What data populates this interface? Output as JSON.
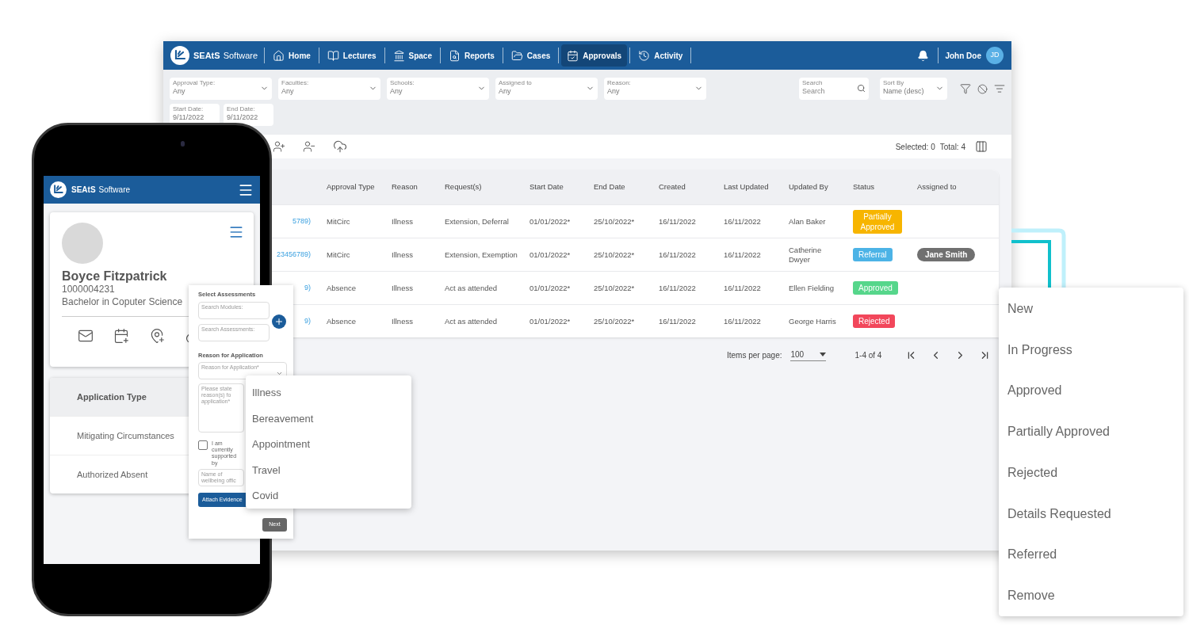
{
  "desktop": {
    "nav": {
      "brand": "SEAtS",
      "product": "Software",
      "items": [
        {
          "label": "Home",
          "selected": false
        },
        {
          "label": "Lectures",
          "selected": false
        },
        {
          "label": "Space",
          "selected": false
        },
        {
          "label": "Reports",
          "selected": false
        },
        {
          "label": "Cases",
          "selected": false
        },
        {
          "label": "Approvals",
          "selected": true
        },
        {
          "label": "Activity",
          "selected": false
        }
      ],
      "user": "John Doe",
      "initials": "JD"
    },
    "filters": [
      {
        "label": "Approval Type:",
        "value": "Any"
      },
      {
        "label": "Faculties:",
        "value": "Any"
      },
      {
        "label": "Schools:",
        "value": "Any"
      },
      {
        "label": "Assigned to",
        "value": "Any"
      },
      {
        "label": "Reason:",
        "value": "Any"
      }
    ],
    "search": {
      "label": "Search",
      "placeholder": "Search"
    },
    "sort": {
      "label": "Sort By",
      "value": "Name (desc)"
    },
    "dates": [
      {
        "label": "Start Date:",
        "value": "9/11/2022"
      },
      {
        "label": "End Date:",
        "value": "9/11/2022"
      }
    ],
    "selected_count": "Selected: 0",
    "total": "Total: 4",
    "table": {
      "columns": [
        "",
        "Approval Type",
        "Reason",
        "Request(s)",
        "Start Date",
        "End Date",
        "Created",
        "Last Updated",
        "Updated By",
        "Status",
        "Assigned to"
      ],
      "rows": [
        {
          "cells": [
            "5789)",
            "MitCirc",
            "Illness",
            "Extension, Deferral",
            "01/01/2022*",
            "25/10/2022*",
            "16/11/2022",
            "16/11/2022",
            "Alan Baker"
          ],
          "status": {
            "label": "Partially Approved",
            "color": "#f7b500"
          }
        },
        {
          "cells": [
            "23456789)",
            "MitCirc",
            "Illness",
            "Extension, Exemption",
            "01/01/2022*",
            "25/10/2022*",
            "16/11/2022",
            "16/11/2022",
            "Catherine Dwyer"
          ],
          "status": {
            "label": "Referral",
            "color": "#4cb3e6"
          },
          "assigned_to": "Jane Smith"
        },
        {
          "cells": [
            "9)",
            "Absence",
            "Illness",
            "Act as attended",
            "01/01/2022*",
            "25/10/2022*",
            "16/11/2022",
            "16/11/2022",
            "Ellen Fielding"
          ],
          "status": {
            "label": "Approved",
            "color": "#56d68b"
          }
        },
        {
          "cells": [
            "9)",
            "Absence",
            "Illness",
            "Act as attended",
            "01/01/2022*",
            "25/10/2022*",
            "16/11/2022",
            "16/11/2022",
            "George Harris"
          ],
          "status": {
            "label": "Rejected",
            "color": "#f2475b"
          }
        }
      ]
    },
    "pagination": {
      "label": "Items per page:",
      "per_page": "100",
      "range": "1-4 of 4"
    }
  },
  "phone": {
    "brand": "SEAtS",
    "product": "Software",
    "profile": {
      "name": "Boyce Fitzpatrick",
      "id": "1000004231",
      "programme": "Bachelor in Coputer Science"
    },
    "application_types": {
      "header": "Application Type",
      "items": [
        "Mitigating Circumstances",
        "Authorized Absent"
      ]
    }
  },
  "application_form": {
    "assessments_title": "Select Assessments",
    "modules_label": "Search Modules:",
    "assessments_label": "Search Assessments:",
    "reason_title": "Reason for Application",
    "reason_label": "Reason for Application*",
    "reasons_text_label": "Please state reason(s) fo application*",
    "supported": {
      "label": "I am currently supported by",
      "checked": false
    },
    "officer_label": "Name of wellbeing offic",
    "attach_button": "Attach Evidence",
    "next_button": "Next"
  },
  "reason_options": [
    "Illness",
    "Bereavement",
    "Appointment",
    "Travel",
    "Covid"
  ],
  "status_menu": [
    "New",
    "In Progress",
    "Approved",
    "Partially Approved",
    "Rejected",
    "Details Requested",
    "Referred",
    "Remove"
  ]
}
